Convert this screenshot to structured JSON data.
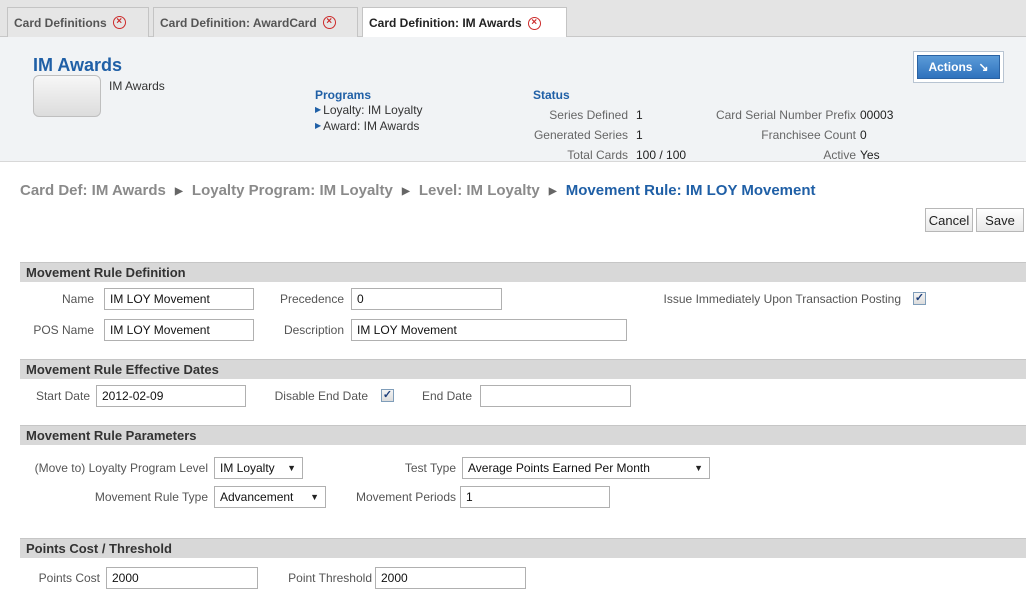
{
  "tabs": [
    {
      "label": "Card Definitions"
    },
    {
      "label": "Card Definition: AwardCard"
    },
    {
      "label": "Card Definition: IM Awards"
    }
  ],
  "header": {
    "title": "IM Awards",
    "card_name": "IM Awards",
    "programs_heading": "Programs",
    "programs": [
      "Loyalty: IM Loyalty",
      "Award: IM Awards"
    ],
    "status_heading": "Status",
    "series_defined_label": "Series Defined",
    "series_defined": "1",
    "generated_series_label": "Generated Series",
    "generated_series": "1",
    "total_cards_label": "Total Cards",
    "total_cards": "100 / 100",
    "serial_prefix_label": "Card Serial Number Prefix",
    "serial_prefix": "00003",
    "franchisee_label": "Franchisee Count",
    "franchisee": "0",
    "active_label": "Active",
    "active": "Yes",
    "actions_label": "Actions"
  },
  "breadcrumb": [
    "Card Def: IM Awards",
    "Loyalty Program: IM Loyalty",
    "Level: IM Loyalty",
    "Movement Rule: IM LOY Movement"
  ],
  "buttons": {
    "cancel": "Cancel",
    "save": "Save"
  },
  "definition": {
    "heading": "Movement Rule Definition",
    "name_label": "Name",
    "name": "IM LOY Movement",
    "precedence_label": "Precedence",
    "precedence": "0",
    "issue_label": "Issue Immediately Upon Transaction Posting",
    "issue_checked": true,
    "pos_label": "POS Name",
    "pos_name": "IM LOY Movement",
    "description_label": "Description",
    "description": "IM LOY Movement"
  },
  "dates": {
    "heading": "Movement Rule Effective Dates",
    "start_label": "Start Date",
    "start": "2012-02-09",
    "disable_end_label": "Disable End Date",
    "disable_end_checked": true,
    "end_label": "End Date",
    "end": ""
  },
  "parameters": {
    "heading": "Movement Rule Parameters",
    "level_label": "(Move to) Loyalty Program Level",
    "level": "IM Loyalty",
    "test_type_label": "Test Type",
    "test_type": "Average Points Earned Per Month",
    "rule_type_label": "Movement Rule Type",
    "rule_type": "Advancement",
    "periods_label": "Movement Periods",
    "periods": "1"
  },
  "points": {
    "heading": "Points Cost / Threshold",
    "cost_label": "Points Cost",
    "cost": "2000",
    "threshold_label": "Point Threshold",
    "threshold": "2000"
  },
  "icons": {
    "tab_close": "close-circle-icon",
    "program_bullet": "triangle-right-icon",
    "actions_arrow": "arrow-down-right-icon",
    "breadcrumb_sep": "triangle-right-icon",
    "select_caret": "caret-down-icon"
  },
  "colors": {
    "accent": "#1f5fa6",
    "close": "#cc2a2a",
    "section_bg": "#d8d8d8"
  }
}
